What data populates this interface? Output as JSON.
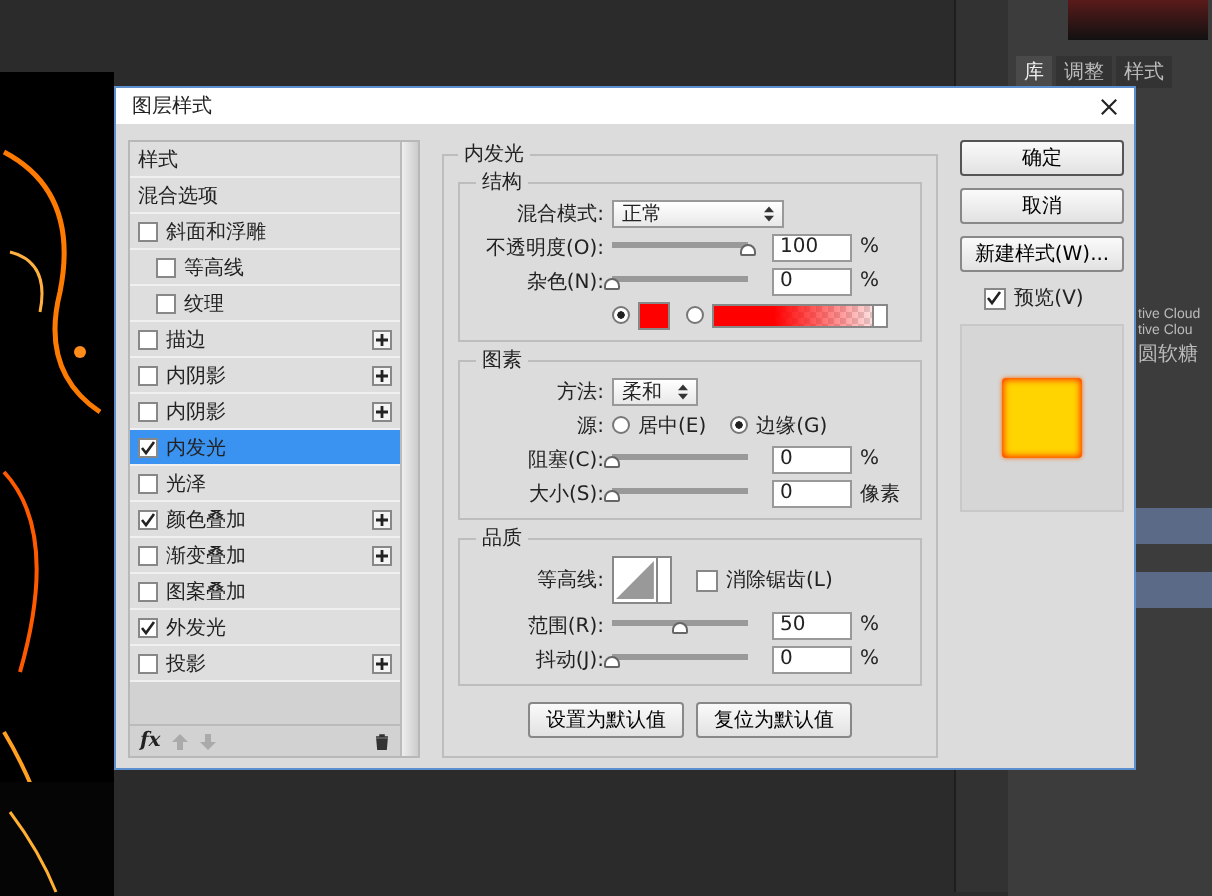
{
  "workspace": {
    "panel_tabs": [
      {
        "label": "库",
        "selected": true
      },
      {
        "label": "调整",
        "selected": false
      },
      {
        "label": "样式",
        "selected": false
      }
    ],
    "behind_texts": [
      "tive Cloud",
      "tive Clou",
      "圆软糖"
    ]
  },
  "dialog": {
    "title": "图层样式",
    "styles_list": [
      {
        "label": "样式",
        "kind": "header",
        "selected": false
      },
      {
        "label": "混合选项",
        "kind": "header",
        "selected": false
      },
      {
        "label": "斜面和浮雕",
        "kind": "check",
        "checked": false,
        "selected": false,
        "add": false,
        "children": [
          {
            "label": "等高线",
            "kind": "check",
            "checked": false,
            "selected": false,
            "add": false
          },
          {
            "label": "纹理",
            "kind": "check",
            "checked": false,
            "selected": false,
            "add": false
          }
        ]
      },
      {
        "label": "描边",
        "kind": "check",
        "checked": false,
        "selected": false,
        "add": true
      },
      {
        "label": "内阴影",
        "kind": "check",
        "checked": false,
        "selected": false,
        "add": true
      },
      {
        "label": "内阴影",
        "kind": "check",
        "checked": false,
        "selected": false,
        "add": true
      },
      {
        "label": "内发光",
        "kind": "check",
        "checked": true,
        "selected": true,
        "add": false
      },
      {
        "label": "光泽",
        "kind": "check",
        "checked": false,
        "selected": false,
        "add": false
      },
      {
        "label": "颜色叠加",
        "kind": "check",
        "checked": true,
        "selected": false,
        "add": true
      },
      {
        "label": "渐变叠加",
        "kind": "check",
        "checked": false,
        "selected": false,
        "add": true
      },
      {
        "label": "图案叠加",
        "kind": "check",
        "checked": false,
        "selected": false,
        "add": false
      },
      {
        "label": "外发光",
        "kind": "check",
        "checked": true,
        "selected": false,
        "add": false
      },
      {
        "label": "投影",
        "kind": "check",
        "checked": false,
        "selected": false,
        "add": true
      }
    ],
    "list_toolbar": {
      "fx": "fx"
    },
    "panel": {
      "title": "内发光",
      "structure": {
        "title": "结构",
        "blend_mode": {
          "label": "混合模式:",
          "value": "正常"
        },
        "sliders": [
          {
            "label": "不透明度(O):",
            "level": 1,
            "value": "100",
            "unit": "%"
          },
          {
            "label": "杂色(N):",
            "level": 0,
            "value": "0",
            "unit": "%"
          }
        ],
        "fill_options": [
          {
            "kind": "color",
            "selected": true,
            "color": "#ff0000"
          },
          {
            "kind": "gradient",
            "selected": false,
            "color": "#ff0000"
          }
        ]
      },
      "elements": {
        "title": "图素",
        "technique": {
          "label": "方法:",
          "value": "柔和"
        },
        "source": {
          "label": "源:",
          "options": [
            {
              "label": "居中(E)",
              "selected": false
            },
            {
              "label": "边缘(G)",
              "selected": true
            }
          ]
        },
        "sliders": [
          {
            "label": "阻塞(C):",
            "level": 0,
            "value": "0",
            "unit": "%"
          },
          {
            "label": "大小(S):",
            "level": 0,
            "value": "0",
            "unit": "像素"
          }
        ]
      },
      "quality": {
        "title": "品质",
        "contour_label": "等高线:",
        "anti_alias": {
          "label": "消除锯齿(L)",
          "checked": false
        },
        "sliders": [
          {
            "label": "范围(R):",
            "level": 0.5,
            "value": "50",
            "unit": "%"
          },
          {
            "label": "抖动(J):",
            "level": 0,
            "value": "0",
            "unit": "%"
          }
        ]
      },
      "buttons": [
        "设置为默认值",
        "复位为默认值"
      ]
    },
    "actions": [
      "确定",
      "取消",
      "新建样式(W)..."
    ],
    "preview": {
      "label": "预览(V)",
      "checked": true
    }
  }
}
